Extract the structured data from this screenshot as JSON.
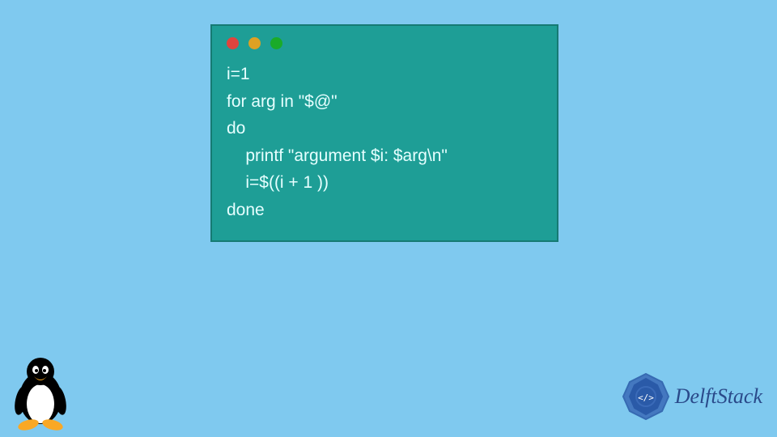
{
  "terminal": {
    "dots": [
      "red",
      "yellow",
      "green"
    ],
    "code_lines": [
      "i=1",
      "for arg in \"$@\"",
      "do",
      "    printf \"argument $i: $arg\\n\"",
      "    i=$((i + 1 ))",
      "done"
    ]
  },
  "brand": {
    "name": "DelftStack"
  },
  "icons": {
    "tux": "tux-penguin-icon",
    "brand": "delftstack-mandala-icon"
  }
}
